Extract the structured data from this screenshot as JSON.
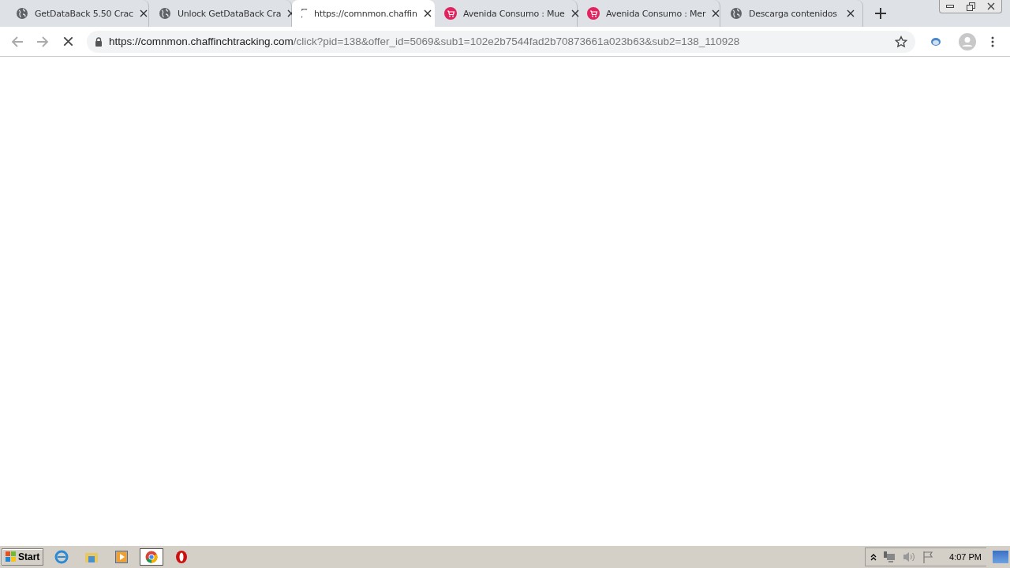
{
  "tabs": [
    {
      "title": "GetDataBack 5.50 Crac",
      "kind": "globe",
      "selected": false
    },
    {
      "title": "Unlock GetDataBack Cra",
      "kind": "globe",
      "selected": false
    },
    {
      "title": "https://comnmon.chaffin",
      "kind": "loading",
      "selected": true
    },
    {
      "title": "Avenida Consumo : Mue",
      "kind": "cart",
      "selected": false
    },
    {
      "title": "Avenida Consumo : Mer",
      "kind": "cart",
      "selected": false
    },
    {
      "title": "Descarga contenidos",
      "kind": "globe",
      "selected": false
    }
  ],
  "toolbar": {
    "loading": true,
    "url_host": "https://comnmon.chaffinchtracking.com",
    "url_path": "/click?pid=138&offer_id=5069&sub1=102e2b7544fad2b70873661a023b63&sub2=138_110928"
  },
  "taskbar": {
    "start": "Start",
    "apps": [
      {
        "kind": "ie",
        "selected": false
      },
      {
        "kind": "explorer",
        "selected": false
      },
      {
        "kind": "media",
        "selected": false
      },
      {
        "kind": "chrome",
        "selected": true
      },
      {
        "kind": "opera",
        "selected": false
      }
    ],
    "clock": "4:07 PM"
  }
}
